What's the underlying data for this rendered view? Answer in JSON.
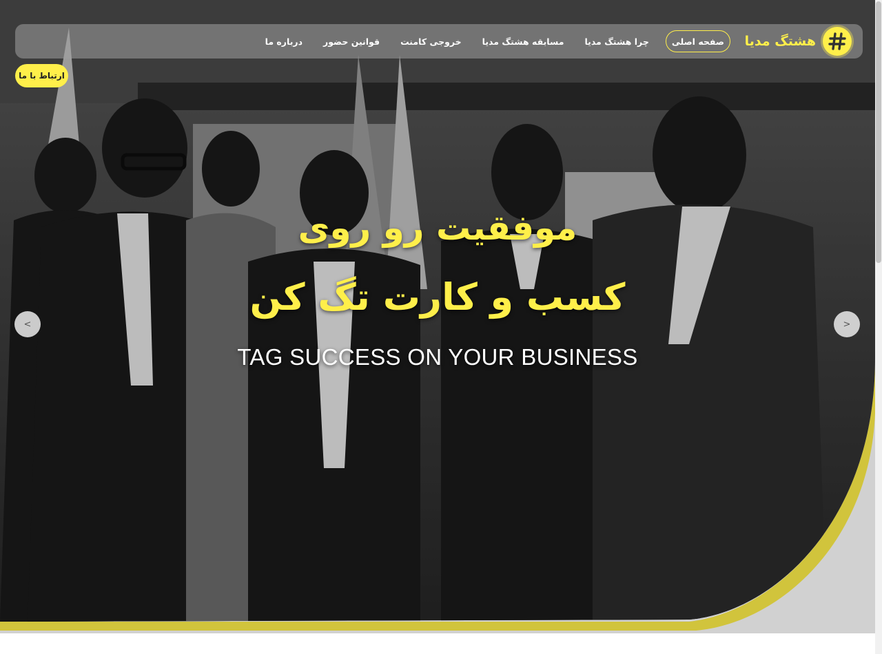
{
  "brand": {
    "name": "هشتگ مدیا",
    "logo_glyph": "#"
  },
  "nav": {
    "items": [
      {
        "label": "صفحه اصلی",
        "active": true
      },
      {
        "label": "چرا هشتگ مدیا"
      },
      {
        "label": "مسابقه هشتگ مدیا"
      },
      {
        "label": "خروجی کامنت"
      },
      {
        "label": "قوانین حضور"
      },
      {
        "label": "درباره ما"
      }
    ],
    "contact_label": "ارتباط با ما"
  },
  "hero": {
    "headline_line1": "موفقیت رو روی",
    "headline_line2": "کسب و کارت تگ کن",
    "subtitle": "TAG SUCCESS ON YOUR BUSINESS",
    "prev_label": "<",
    "next_label": ">",
    "image_description_icon": "group-photo"
  },
  "colors": {
    "accent": "#ffef4a",
    "nav_bg": "#a0a0a0",
    "text_white": "#ffffff"
  }
}
